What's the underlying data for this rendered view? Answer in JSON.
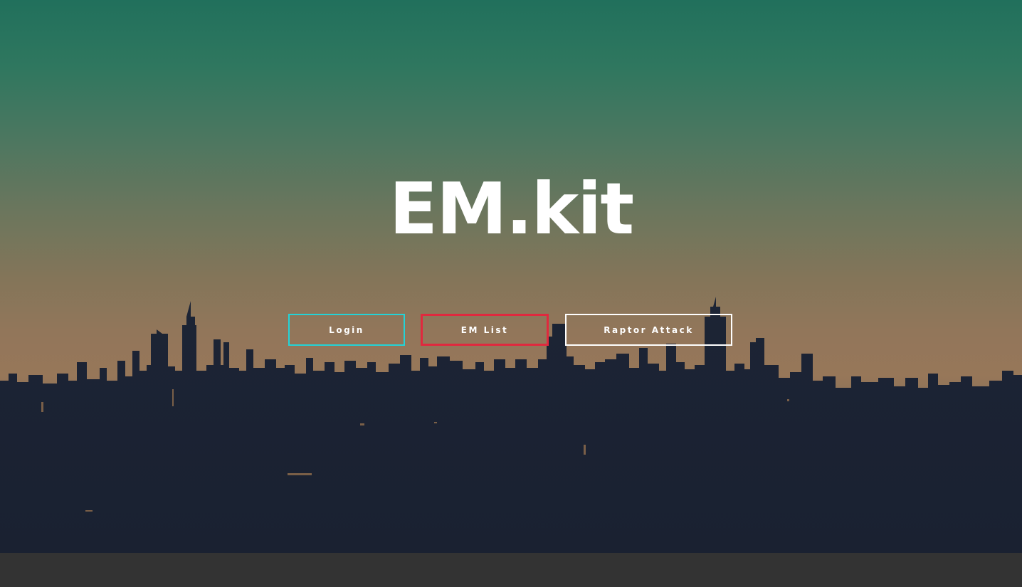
{
  "hero": {
    "title": "EM.kit",
    "image": "city-skyline-background"
  },
  "buttons": {
    "login_label": "Login",
    "em_list_label": "EM List",
    "raptor_label": "Raptor Attack"
  },
  "colors": {
    "login_border": "#22d3d8",
    "em_list_border": "#e0293e",
    "raptor_border": "#ffffff",
    "footer": "#333333"
  }
}
